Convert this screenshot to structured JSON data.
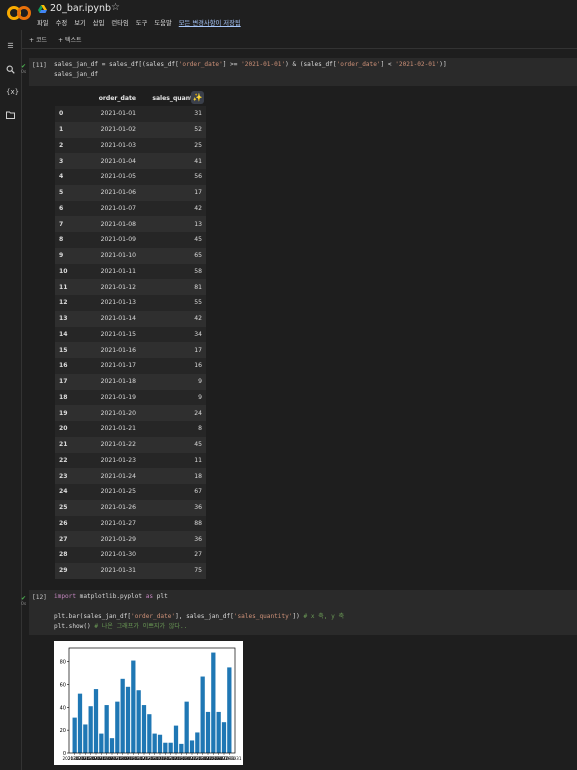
{
  "header": {
    "filename": "20_bar.ipynb",
    "menu": [
      "파일",
      "수정",
      "보기",
      "삽입",
      "런타임",
      "도구",
      "도움말"
    ],
    "saved_status": "모든 변경사항이 저장됨"
  },
  "toolbar": {
    "add_code": "코드",
    "add_text": "텍스트"
  },
  "cell1": {
    "number": "[11]",
    "line1_a": "sales_jan_df = sales_df[(sales_df[",
    "line1_b": "'order_date'",
    "line1_c": "] >= ",
    "line1_d": "'2021-01-01'",
    "line1_e": ") & (sales_df[",
    "line1_f": "'order_date'",
    "line1_g": "] < ",
    "line1_h": "'2021-02-01'",
    "line1_i": ")]",
    "line2": "sales_jan_df"
  },
  "table": {
    "columns": [
      "order_date",
      "sales_quantity"
    ],
    "rows": [
      [
        "0",
        "2021-01-01",
        "31"
      ],
      [
        "1",
        "2021-01-02",
        "52"
      ],
      [
        "2",
        "2021-01-03",
        "25"
      ],
      [
        "3",
        "2021-01-04",
        "41"
      ],
      [
        "4",
        "2021-01-05",
        "56"
      ],
      [
        "5",
        "2021-01-06",
        "17"
      ],
      [
        "6",
        "2021-01-07",
        "42"
      ],
      [
        "7",
        "2021-01-08",
        "13"
      ],
      [
        "8",
        "2021-01-09",
        "45"
      ],
      [
        "9",
        "2021-01-10",
        "65"
      ],
      [
        "10",
        "2021-01-11",
        "58"
      ],
      [
        "11",
        "2021-01-12",
        "81"
      ],
      [
        "12",
        "2021-01-13",
        "55"
      ],
      [
        "13",
        "2021-01-14",
        "42"
      ],
      [
        "14",
        "2021-01-15",
        "34"
      ],
      [
        "15",
        "2021-01-16",
        "17"
      ],
      [
        "16",
        "2021-01-17",
        "16"
      ],
      [
        "17",
        "2021-01-18",
        "9"
      ],
      [
        "18",
        "2021-01-19",
        "9"
      ],
      [
        "19",
        "2021-01-20",
        "24"
      ],
      [
        "20",
        "2021-01-21",
        "8"
      ],
      [
        "21",
        "2021-01-22",
        "45"
      ],
      [
        "22",
        "2021-01-23",
        "11"
      ],
      [
        "23",
        "2021-01-24",
        "18"
      ],
      [
        "24",
        "2021-01-25",
        "67"
      ],
      [
        "25",
        "2021-01-26",
        "36"
      ],
      [
        "26",
        "2021-01-27",
        "88"
      ],
      [
        "27",
        "2021-01-29",
        "36"
      ],
      [
        "28",
        "2021-01-30",
        "27"
      ],
      [
        "29",
        "2021-01-31",
        "75"
      ]
    ]
  },
  "cell2": {
    "number": "[12]",
    "import_kw": "import",
    "import_mod": " matplotlib.pyplot ",
    "as_kw": "as",
    "alias": " plt",
    "bar_a": "plt.bar(sales_jan_df[",
    "bar_b": "'order_date'",
    "bar_c": "], sales_jan_df[",
    "bar_d": "'sales_quantity'",
    "bar_e": "]) ",
    "bar_comment": "# x 축, y 축",
    "show": "plt.show() ",
    "show_comment": "# 나온 그래프가 이쁘지가 않다.."
  },
  "chart_data": {
    "type": "bar",
    "categories": [
      "2021-01-01",
      "2021-01-02",
      "2021-01-03",
      "2021-01-04",
      "2021-01-05",
      "2021-01-06",
      "2021-01-07",
      "2021-01-08",
      "2021-01-09",
      "2021-01-10",
      "2021-01-11",
      "2021-01-12",
      "2021-01-13",
      "2021-01-14",
      "2021-01-15",
      "2021-01-16",
      "2021-01-17",
      "2021-01-18",
      "2021-01-19",
      "2021-01-20",
      "2021-01-21",
      "2021-01-22",
      "2021-01-23",
      "2021-01-24",
      "2021-01-25",
      "2021-01-26",
      "2021-01-27",
      "2021-01-29",
      "2021-01-30",
      "2021-01-31"
    ],
    "values": [
      31,
      52,
      25,
      41,
      56,
      17,
      42,
      13,
      45,
      65,
      58,
      81,
      55,
      42,
      34,
      17,
      16,
      9,
      9,
      24,
      8,
      45,
      11,
      18,
      67,
      36,
      88,
      36,
      27,
      75
    ],
    "yticks": [
      0,
      20,
      40,
      60,
      80
    ],
    "ylim": [
      0,
      92
    ],
    "bar_color": "#1f77b4",
    "grid": false
  },
  "colors": {
    "accent": "#a8c7fa",
    "run_ok": "#4caf50"
  }
}
